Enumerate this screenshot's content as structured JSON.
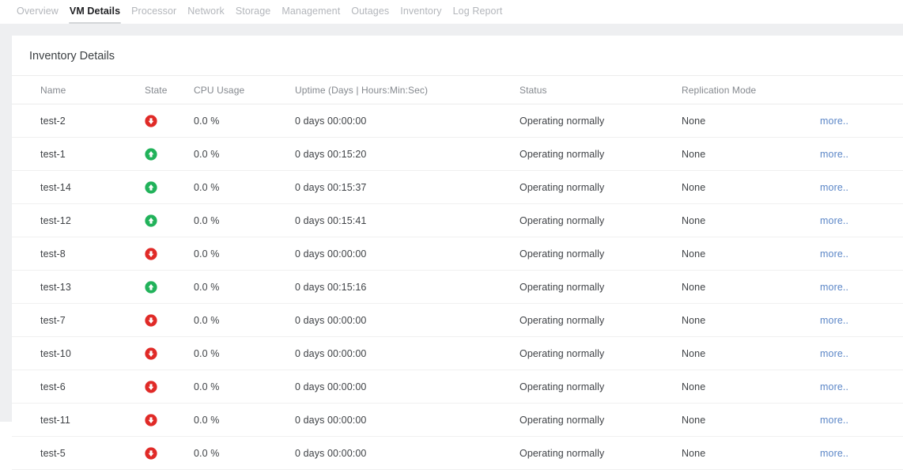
{
  "tabs": [
    {
      "label": "Overview",
      "active": false
    },
    {
      "label": "VM Details",
      "active": true
    },
    {
      "label": "Processor",
      "active": false
    },
    {
      "label": "Network",
      "active": false
    },
    {
      "label": "Storage",
      "active": false
    },
    {
      "label": "Management",
      "active": false
    },
    {
      "label": "Outages",
      "active": false
    },
    {
      "label": "Inventory",
      "active": false
    },
    {
      "label": "Log Report",
      "active": false
    }
  ],
  "card": {
    "title": "Inventory Details"
  },
  "table": {
    "columns": [
      "Name",
      "State",
      "CPU Usage",
      "Uptime (Days | Hours:Min:Sec)",
      "Status",
      "Replication Mode",
      ""
    ],
    "more_label": "more..",
    "rows": [
      {
        "name": "test-2",
        "state": "down",
        "cpu": "0.0 %",
        "uptime": "0 days 00:00:00",
        "status": "Operating normally",
        "replication": "None",
        "more": "more.."
      },
      {
        "name": "test-1",
        "state": "up",
        "cpu": "0.0 %",
        "uptime": "0 days 00:15:20",
        "status": "Operating normally",
        "replication": "None",
        "more": "more.."
      },
      {
        "name": "test-14",
        "state": "up",
        "cpu": "0.0 %",
        "uptime": "0 days 00:15:37",
        "status": "Operating normally",
        "replication": "None",
        "more": "more.."
      },
      {
        "name": "test-12",
        "state": "up",
        "cpu": "0.0 %",
        "uptime": "0 days 00:15:41",
        "status": "Operating normally",
        "replication": "None",
        "more": "more.."
      },
      {
        "name": "test-8",
        "state": "down",
        "cpu": "0.0 %",
        "uptime": "0 days 00:00:00",
        "status": "Operating normally",
        "replication": "None",
        "more": "more.."
      },
      {
        "name": "test-13",
        "state": "up",
        "cpu": "0.0 %",
        "uptime": "0 days 00:15:16",
        "status": "Operating normally",
        "replication": "None",
        "more": "more.."
      },
      {
        "name": "test-7",
        "state": "down",
        "cpu": "0.0 %",
        "uptime": "0 days 00:00:00",
        "status": "Operating normally",
        "replication": "None",
        "more": "more.."
      },
      {
        "name": "test-10",
        "state": "down",
        "cpu": "0.0 %",
        "uptime": "0 days 00:00:00",
        "status": "Operating normally",
        "replication": "None",
        "more": "more.."
      },
      {
        "name": "test-6",
        "state": "down",
        "cpu": "0.0 %",
        "uptime": "0 days 00:00:00",
        "status": "Operating normally",
        "replication": "None",
        "more": "more.."
      },
      {
        "name": "test-11",
        "state": "down",
        "cpu": "0.0 %",
        "uptime": "0 days 00:00:00",
        "status": "Operating normally",
        "replication": "None",
        "more": "more.."
      },
      {
        "name": "test-5",
        "state": "down",
        "cpu": "0.0 %",
        "uptime": "0 days 00:00:00",
        "status": "Operating normally",
        "replication": "None",
        "more": "more.."
      }
    ]
  },
  "icons": {
    "state_up": {
      "name": "circle-arrow-up-icon",
      "color": "#21b25a",
      "title": "Running"
    },
    "state_down": {
      "name": "circle-arrow-down-icon",
      "color": "#e02a27",
      "title": "Stopped"
    }
  },
  "colors": {
    "page_background": "#eeeff1",
    "card_background": "#ffffff",
    "link": "#5b86c7",
    "text": "#3f4246",
    "muted_text": "#84888e",
    "tab_inactive": "#b3b6bb",
    "tab_active": "#202124"
  }
}
